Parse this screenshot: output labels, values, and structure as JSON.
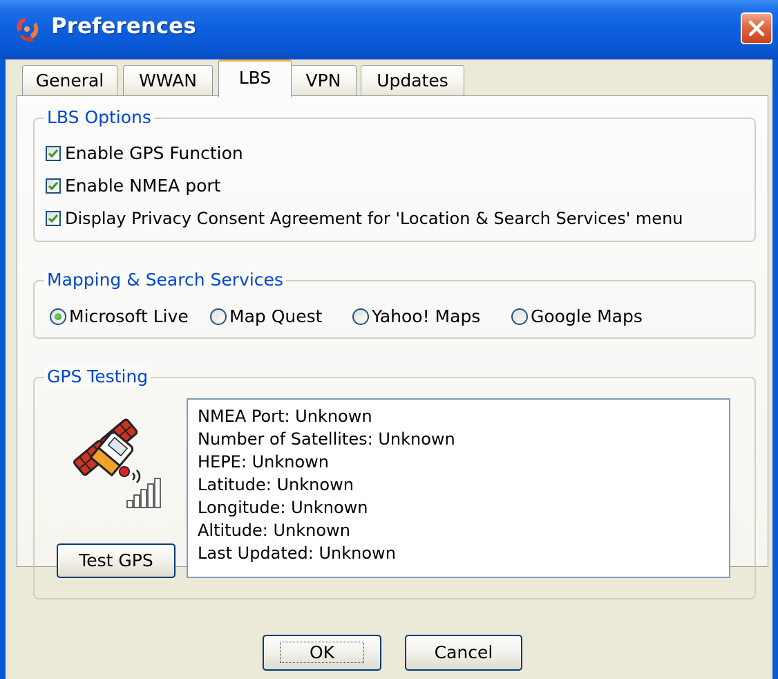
{
  "window": {
    "title": "Preferences"
  },
  "tabs": [
    {
      "label": "General",
      "active": false
    },
    {
      "label": "WWAN",
      "active": false
    },
    {
      "label": "LBS",
      "active": true
    },
    {
      "label": "VPN",
      "active": false
    },
    {
      "label": "Updates",
      "active": false
    }
  ],
  "lbs_options": {
    "legend": "LBS Options",
    "checkboxes": [
      {
        "label": "Enable GPS Function",
        "checked": true
      },
      {
        "label": "Enable NMEA port",
        "checked": true
      },
      {
        "label": "Display Privacy Consent Agreement for 'Location & Search Services' menu",
        "checked": true
      }
    ]
  },
  "mapping": {
    "legend": "Mapping & Search Services",
    "options": [
      {
        "label": "Microsoft Live",
        "selected": true
      },
      {
        "label": "Map Quest",
        "selected": false
      },
      {
        "label": "Yahoo! Maps",
        "selected": false
      },
      {
        "label": "Google Maps",
        "selected": false
      }
    ]
  },
  "gps_testing": {
    "legend": "GPS Testing",
    "test_button": "Test GPS",
    "status_lines": [
      "NMEA Port: Unknown",
      "Number of Satellites: Unknown",
      "HEPE: Unknown",
      "Latitude: Unknown",
      "Longitude: Unknown",
      "Altitude: Unknown",
      "Last Updated: Unknown"
    ]
  },
  "footer": {
    "ok": "OK",
    "cancel": "Cancel"
  },
  "colors": {
    "title_bar": "#0a5ad6",
    "dialog_bg": "#ece9d8",
    "legend_text": "#0046d5",
    "active_tab_accent": "#f2b43f",
    "check_mark": "#21a121",
    "close_button": "#e2673f"
  },
  "icons": {
    "title": "app-logo-icon",
    "close": "close-icon",
    "gps": "satellite-signal-icon"
  }
}
